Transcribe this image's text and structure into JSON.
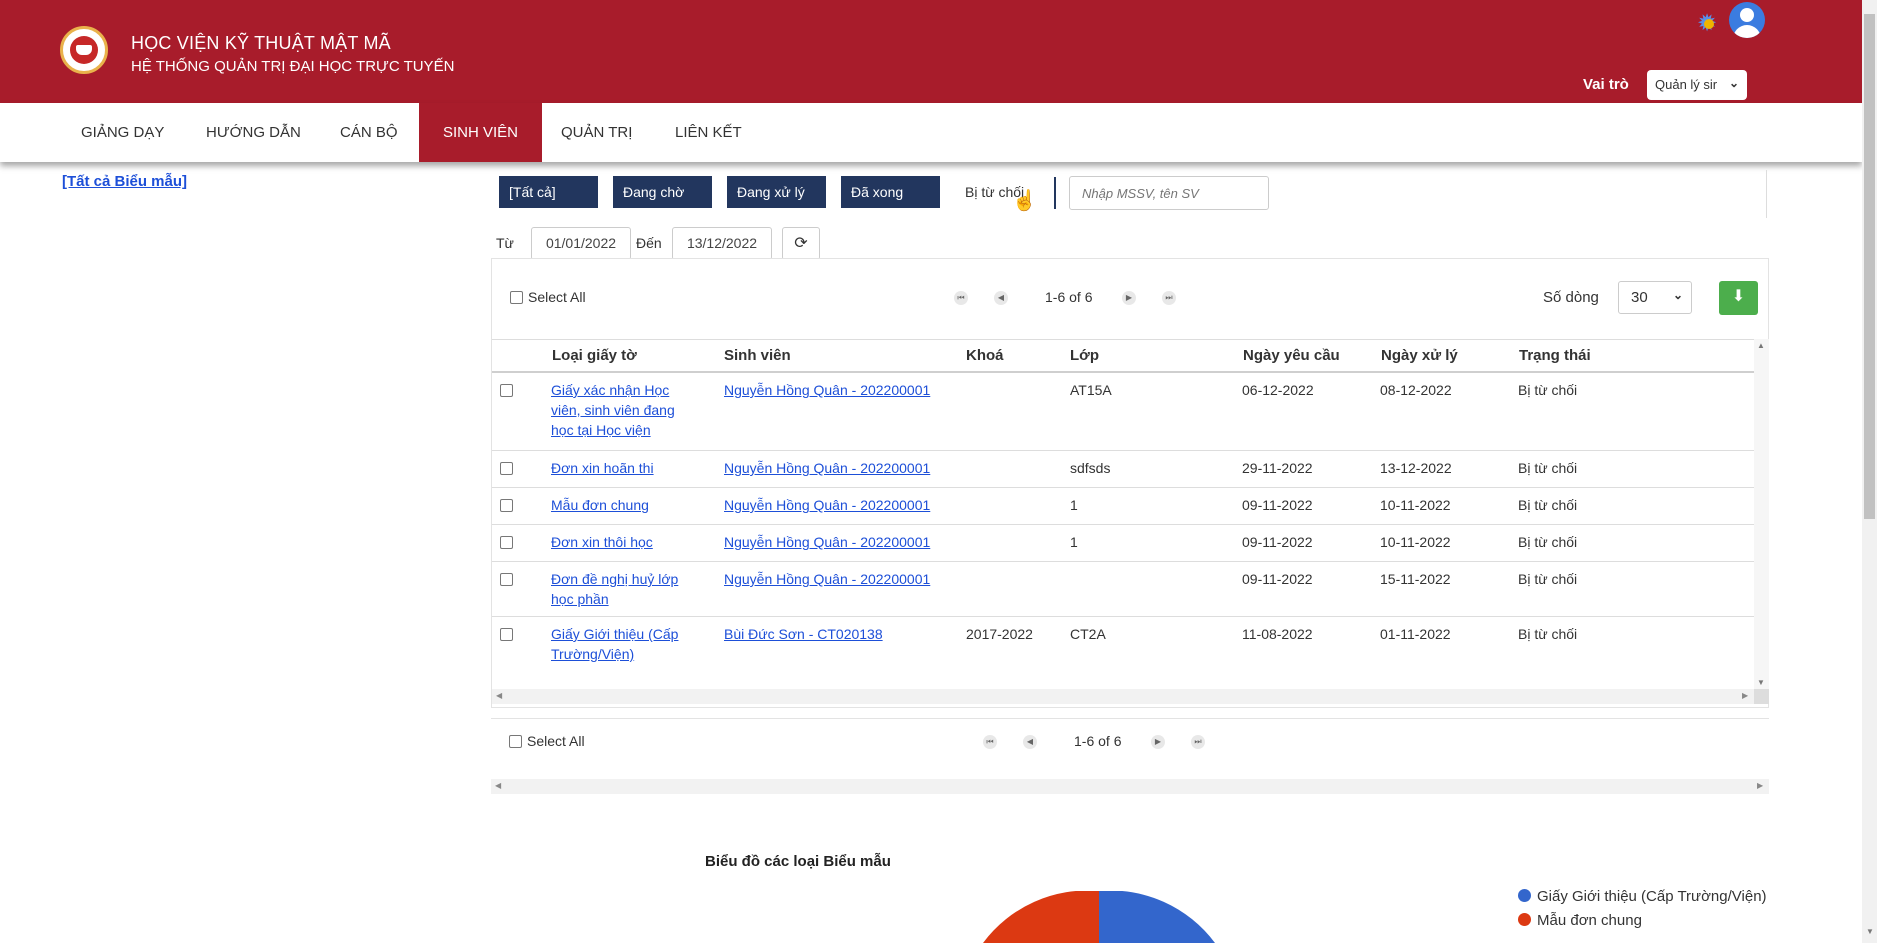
{
  "header": {
    "brand_title": "HỌC VIỆN KỸ THUẬT MẬT MÃ",
    "brand_subtitle": "HỆ THỐNG QUẢN TRỊ ĐẠI HỌC TRỰC TUYẾN",
    "role_label": "Vai trò",
    "role_value": "Quản lý sir"
  },
  "nav": {
    "items": [
      {
        "label": "GIẢNG DẠY"
      },
      {
        "label": "HƯỚNG DẪN"
      },
      {
        "label": "CÁN BỘ"
      },
      {
        "label": "SINH VIÊN"
      },
      {
        "label": "QUẢN TRỊ"
      },
      {
        "label": "LIÊN KẾT"
      }
    ],
    "active": "SINH VIÊN"
  },
  "sidebar": {
    "all_forms": "[Tất cả Biểu mẫu]"
  },
  "filters": {
    "tabs": [
      {
        "label": "[Tất cả]"
      },
      {
        "label": "Đang chờ"
      },
      {
        "label": "Đang xử lý"
      },
      {
        "label": "Đã xong"
      },
      {
        "label": "Bị từ chối"
      }
    ],
    "search_placeholder": "Nhập MSSV, tên SV",
    "from_label": "Từ",
    "from_value": "01/01/2022",
    "to_label": "Đến",
    "to_value": "13/12/2022"
  },
  "grid": {
    "select_all": "Select All",
    "page_info": "1-6 of 6",
    "rows_label": "Số dòng",
    "rows_value": "30",
    "columns": [
      "Loại giấy tờ",
      "Sinh viên",
      "Khoá",
      "Lớp",
      "Ngày yêu cầu",
      "Ngày xử lý",
      "Trạng thái"
    ],
    "rows": [
      {
        "type_lines": [
          "Giấy xác nhận Học",
          "viên, sinh viên đang",
          "học tại Học viện"
        ],
        "student": "Nguyễn Hồng Quân - 202200001",
        "khoa": "",
        "lop": "AT15A",
        "req": "06-12-2022",
        "done": "08-12-2022",
        "status": "Bị từ chối"
      },
      {
        "type_lines": [
          "Đơn xin hoãn thi"
        ],
        "student": "Nguyễn Hồng Quân - 202200001",
        "khoa": "",
        "lop": "sdfsds",
        "req": "29-11-2022",
        "done": "13-12-2022",
        "status": "Bị từ chối"
      },
      {
        "type_lines": [
          "Mẫu đơn chung"
        ],
        "student": "Nguyễn Hồng Quân - 202200001",
        "khoa": "",
        "lop": "1",
        "req": "09-11-2022",
        "done": "10-11-2022",
        "status": "Bị từ chối"
      },
      {
        "type_lines": [
          "Đơn xin thôi học"
        ],
        "student": "Nguyễn Hồng Quân - 202200001",
        "khoa": "",
        "lop": "1",
        "req": "09-11-2022",
        "done": "10-11-2022",
        "status": "Bị từ chối"
      },
      {
        "type_lines": [
          "Đơn đề nghị huỷ lớp",
          "học phần"
        ],
        "student": "Nguyễn Hồng Quân - 202200001",
        "khoa": "",
        "lop": "",
        "req": "09-11-2022",
        "done": "15-11-2022",
        "status": "Bị từ chối"
      },
      {
        "type_lines": [
          "Giấy Giới thiệu (Cấp",
          "Trường/Viện)"
        ],
        "student": "Bùi Đức Sơn - CT020138",
        "khoa": "2017-2022",
        "lop": "CT2A",
        "req": "11-08-2022",
        "done": "01-11-2022",
        "status": "Bị từ chối"
      }
    ]
  },
  "chart": {
    "title": "Biểu đồ các loại Biểu mẫu",
    "legend": [
      {
        "label": "Giấy Giới thiệu (Cấp Trường/Viện)",
        "color": "#3366cc"
      },
      {
        "label": "Mẫu đơn chung",
        "color": "#dc3912"
      }
    ]
  },
  "colors": {
    "brand": "#a81c2b",
    "tab": "#22365e",
    "link": "#1d4fd8",
    "download": "#4cae4c"
  }
}
